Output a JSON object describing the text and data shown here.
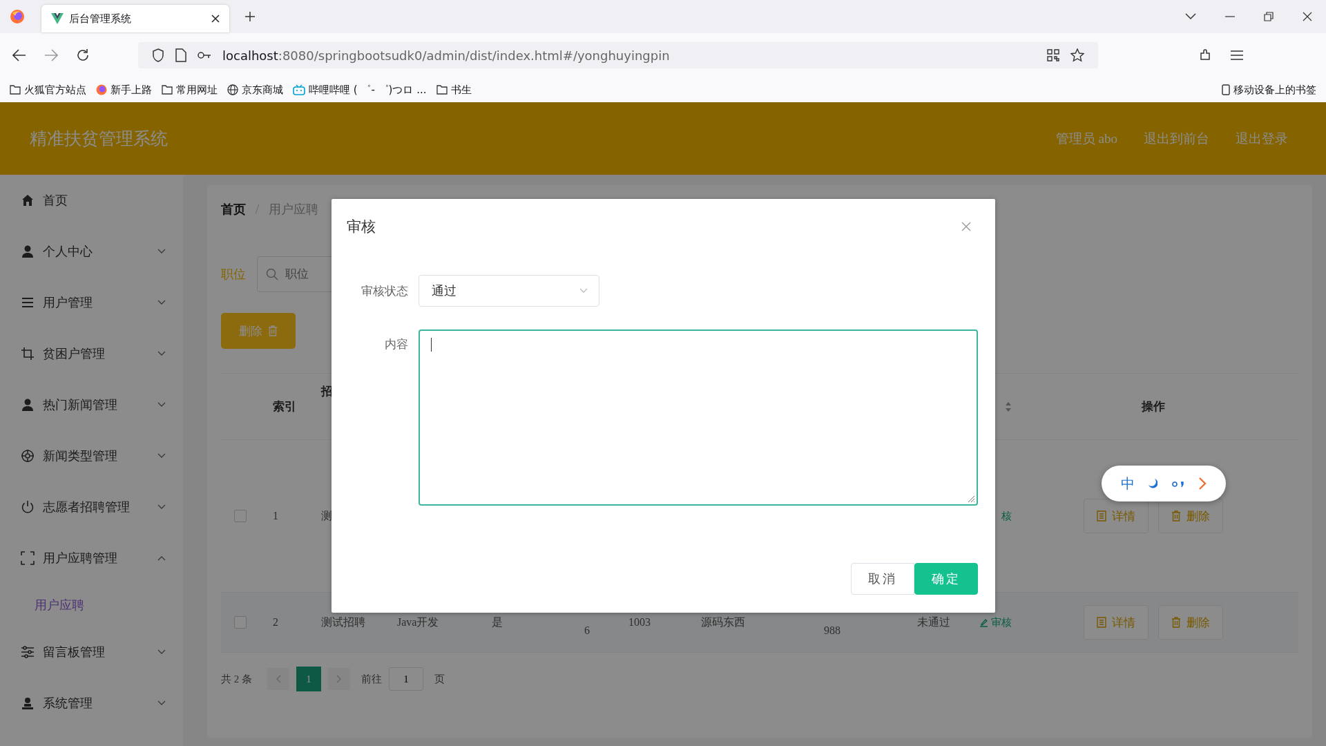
{
  "browser": {
    "tab_title": "后台管理系统",
    "url_host": "localhost",
    "url_rest": ":8080/springbootsudk0/admin/dist/index.html#/yonghuyingpin",
    "bookmarks": [
      {
        "kind": "folder",
        "label": "火狐官方站点"
      },
      {
        "kind": "firefox",
        "label": "新手上路"
      },
      {
        "kind": "folder",
        "label": "常用网址"
      },
      {
        "kind": "globe",
        "label": "京东商城"
      },
      {
        "kind": "bilibili",
        "label": "哔哩哔哩 ( ゜- ゜)つロ ..."
      },
      {
        "kind": "folder",
        "label": "书生"
      }
    ],
    "mobile_bookmarks": "移动设备上的书签"
  },
  "header": {
    "title": "精准扶贫管理系统",
    "user": "管理员 abo",
    "links": [
      "退出到前台",
      "退出登录"
    ]
  },
  "sidebar": {
    "items": [
      {
        "kind": "home",
        "label": "首页"
      },
      {
        "kind": "user",
        "label": "个人中心",
        "expanded": false
      },
      {
        "kind": "list",
        "label": "用户管理",
        "expanded": false
      },
      {
        "kind": "crop",
        "label": "贫困户管理",
        "expanded": false
      },
      {
        "kind": "user",
        "label": "热门新闻管理",
        "expanded": false
      },
      {
        "kind": "target",
        "label": "新闻类型管理",
        "expanded": false
      },
      {
        "kind": "power",
        "label": "志愿者招聘管理",
        "expanded": false
      },
      {
        "kind": "frame",
        "label": "用户应聘管理",
        "expanded": true,
        "children": [
          {
            "label": "用户应聘",
            "selected": true
          }
        ]
      },
      {
        "kind": "sliders",
        "label": "留言板管理",
        "expanded": false
      },
      {
        "kind": "stamp",
        "label": "系统管理",
        "expanded": false
      }
    ]
  },
  "breadcrumb": {
    "items": [
      "首页",
      "用户应聘"
    ],
    "separator": "/"
  },
  "search": {
    "label": "职位",
    "placeholder": "职位"
  },
  "delete_button": "删除",
  "table": {
    "columns": [
      "索引",
      "招",
      "",
      "",
      "",
      "",
      "",
      "",
      "",
      "",
      "操作"
    ],
    "rows": [
      {
        "checked": false,
        "cells": [
          "1",
          "测",
          "",
          "",
          "",
          "",
          "",
          "",
          ""
        ],
        "review": {
          "text": "核",
          "icon": false
        },
        "actions": [
          {
            "kind": "detail",
            "label": "详情"
          },
          {
            "kind": "delete",
            "label": "删除"
          }
        ]
      },
      {
        "checked": false,
        "cells": [
          "2",
          "测试招聘",
          "Java开发",
          "是",
          "6",
          "1003",
          "源码东西",
          "988",
          "未通过"
        ],
        "review": {
          "text": "审核",
          "icon": true
        },
        "actions": [
          {
            "kind": "detail",
            "label": "详情"
          },
          {
            "kind": "delete",
            "label": "删除"
          }
        ]
      }
    ]
  },
  "pagination": {
    "total": "共 2 条",
    "pages": [
      {
        "label": "1",
        "selected": true
      }
    ],
    "goto_label": "前往",
    "goto_value": "1",
    "page_suffix": "页"
  },
  "modal": {
    "title": "审核",
    "fields": [
      {
        "kind": "select",
        "label": "审核状态",
        "value": "通过"
      },
      {
        "kind": "textarea",
        "label": "内容",
        "focused": true
      }
    ],
    "buttons": [
      {
        "kind": "default",
        "label": "取消"
      },
      {
        "kind": "primary",
        "label": "确定"
      }
    ]
  },
  "ime": {
    "label": "中"
  }
}
